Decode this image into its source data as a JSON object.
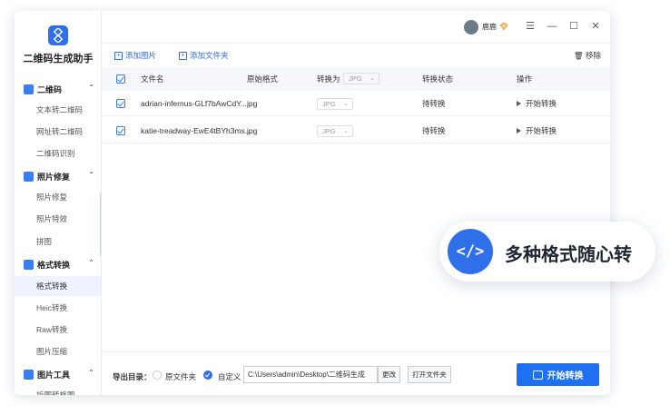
{
  "app": {
    "title": "二维码生成助手"
  },
  "header": {
    "username": "鹿鹿"
  },
  "sidebar": {
    "groups": [
      {
        "label": "二维码",
        "items": [
          "文本转二维码",
          "网址转二维码",
          "二维码识别"
        ]
      },
      {
        "label": "照片修复",
        "items": [
          "照片修复",
          "照片特效",
          "拼图"
        ]
      },
      {
        "label": "格式转换",
        "items": [
          "格式转换",
          "Heic转换",
          "Raw转换",
          "图片压缩"
        ]
      },
      {
        "label": "图片工具",
        "items": [
          "拆图转格图"
        ]
      }
    ],
    "active_item": "格式转换"
  },
  "toolbar": {
    "add_image": "添加图片",
    "add_folder": "添加文件夹",
    "remove": "移除"
  },
  "table": {
    "headers": {
      "filename": "文件名",
      "original_format": "原始格式",
      "convert_to": "转换为",
      "status": "转换状态",
      "action": "操作"
    },
    "header_select": "JPG",
    "rows": [
      {
        "filename": "adrian-infernus-GLf7bAwCdY...",
        "format": "jpg",
        "target": "JPG",
        "status": "待转换",
        "action": "开始转换"
      },
      {
        "filename": "katie-treadway-EwE4tBYh3ms...",
        "format": "jpg",
        "target": "JPG",
        "status": "待转换",
        "action": "开始转换"
      }
    ]
  },
  "footer": {
    "output_label": "导出目录：",
    "option_original": "原文件夹",
    "option_custom": "自定义",
    "path": "C:\\Users\\admin\\Desktop\\二维码生成",
    "change_btn": "更改",
    "open_folder_btn": "打开文件夹",
    "start_btn": "开始转换"
  },
  "callout": {
    "icon_text": "</>",
    "text": "多种格式随心转"
  },
  "colors": {
    "accent": "#2f6fe8",
    "start_button": "#1f6ff2"
  }
}
